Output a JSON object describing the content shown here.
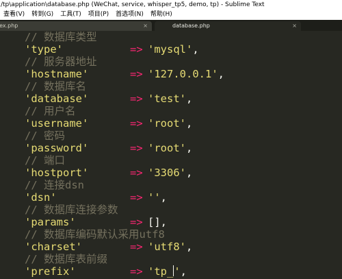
{
  "window": {
    "title": "/tp\\application\\database.php (WeChat, service, whisper_tp5, demo, tp) - Sublime Text"
  },
  "menu": [
    "查看(V)",
    "转到(G)",
    "工具(T)",
    "项目(P)",
    "首选项(N)",
    "帮助(H)"
  ],
  "tabs": [
    {
      "label": "dex.php",
      "close": "×",
      "active": false
    },
    {
      "label": "database.php",
      "close": "×",
      "active": true
    }
  ],
  "code": {
    "arrow": "=>",
    "lines": [
      {
        "comment": "// 数据库类型"
      },
      {
        "key": "'type'",
        "value": "'mysql'",
        "end": ","
      },
      {
        "comment": "// 服务器地址"
      },
      {
        "key": "'hostname'",
        "value": "'127.0.0.1'",
        "end": ","
      },
      {
        "comment": "// 数据库名"
      },
      {
        "key": "'database'",
        "value": "'test'",
        "end": ","
      },
      {
        "comment": "// 用户名"
      },
      {
        "key": "'username'",
        "value": "'root'",
        "end": ","
      },
      {
        "comment": "// 密码"
      },
      {
        "key": "'password'",
        "value": "'root'",
        "end": ","
      },
      {
        "comment": "// 端口"
      },
      {
        "key": "'hostport'",
        "value": "'3306'",
        "end": ","
      },
      {
        "comment": "// 连接dsn"
      },
      {
        "key": "'dsn'",
        "value": "''",
        "end": ","
      },
      {
        "comment": "// 数据库连接参数"
      },
      {
        "key": "'params'",
        "value": "[]",
        "end": ","
      },
      {
        "comment": "// 数据库编码默认采用utf8"
      },
      {
        "key": "'charset'",
        "value": "'utf8'",
        "end": ","
      },
      {
        "comment": "// 数据库表前缀"
      },
      {
        "key": "'prefix'",
        "value_before_cursor": "'tp_",
        "value_after_cursor": "'",
        "end": ","
      }
    ]
  }
}
